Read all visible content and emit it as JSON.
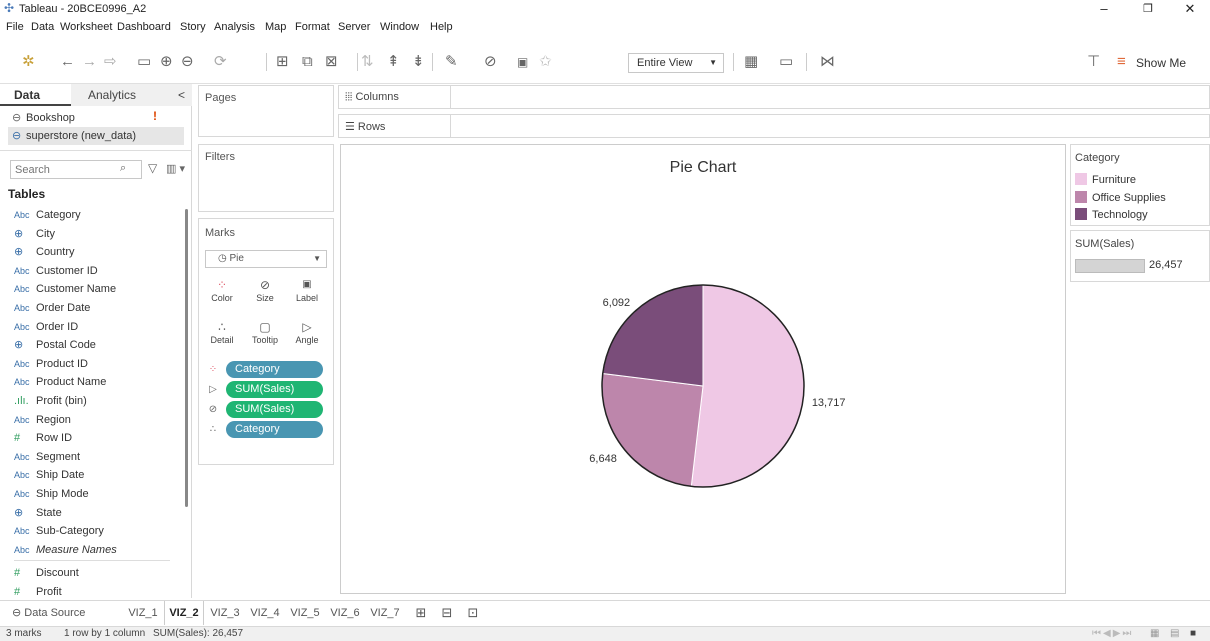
{
  "window": {
    "title": "Tableau - 20BCE0996_A2",
    "minimize": "–",
    "restore": "❐",
    "close": "✕"
  },
  "menu": [
    "File",
    "Data",
    "Worksheet",
    "Dashboard",
    "Story",
    "Analysis",
    "Map",
    "Format",
    "Server",
    "Window",
    "Help"
  ],
  "toolbar": {
    "fit_value": "Entire View",
    "show_me": "Show Me"
  },
  "left_pane": {
    "tabs": [
      "Data",
      "Analytics"
    ],
    "collapse": "<",
    "data_sources": [
      {
        "name": "Bookshop",
        "warning": "!"
      },
      {
        "name": "superstore (new_data)"
      }
    ],
    "search_placeholder": "Search",
    "tables_heading": "Tables",
    "fields": [
      {
        "type": "Abc",
        "name": "Category"
      },
      {
        "type": "⊕",
        "name": "City"
      },
      {
        "type": "⊕",
        "name": "Country"
      },
      {
        "type": "Abc",
        "name": "Customer ID"
      },
      {
        "type": "Abc",
        "name": "Customer Name"
      },
      {
        "type": "Abc",
        "name": "Order Date"
      },
      {
        "type": "Abc",
        "name": "Order ID"
      },
      {
        "type": "⊕",
        "name": "Postal Code"
      },
      {
        "type": "Abc",
        "name": "Product ID"
      },
      {
        "type": "Abc",
        "name": "Product Name"
      },
      {
        "type": ".ılı.",
        "name": "Profit (bin)"
      },
      {
        "type": "Abc",
        "name": "Region"
      },
      {
        "type": "#",
        "name": "Row ID"
      },
      {
        "type": "Abc",
        "name": "Segment"
      },
      {
        "type": "Abc",
        "name": "Ship Date"
      },
      {
        "type": "Abc",
        "name": "Ship Mode"
      },
      {
        "type": "⊕",
        "name": "State"
      },
      {
        "type": "Abc",
        "name": "Sub-Category"
      },
      {
        "type": "Abc",
        "name": "Measure Names"
      },
      {
        "type": "#",
        "name": "Discount"
      },
      {
        "type": "#",
        "name": "Profit"
      }
    ]
  },
  "cards": {
    "pages": "Pages",
    "filters": "Filters",
    "columns": "Columns",
    "rows": "Rows",
    "marks": "Marks",
    "mark_type": "Pie",
    "mark_buttons": [
      "Color",
      "Size",
      "Label",
      "Detail",
      "Tooltip",
      "Angle"
    ],
    "mark_pills": [
      {
        "label": "Category",
        "kind": "blue"
      },
      {
        "label": "SUM(Sales)",
        "kind": "green"
      },
      {
        "label": "SUM(Sales)",
        "kind": "green"
      },
      {
        "label": "Category",
        "kind": "blue"
      }
    ]
  },
  "chart_data": {
    "type": "pie",
    "title": "Pie Chart",
    "categories": [
      "Furniture",
      "Office Supplies",
      "Technology"
    ],
    "values": [
      13717,
      6648,
      6092
    ],
    "labels": [
      "13,717",
      "6,648",
      "6,092"
    ],
    "colors": [
      "#efc8e5",
      "#bd86ab",
      "#7a4d7a"
    ],
    "start_angle_deg": 0
  },
  "legend": {
    "title": "Category",
    "items": [
      {
        "name": "Furniture",
        "color": "#efc8e5"
      },
      {
        "name": "Office Supplies",
        "color": "#bd86ab"
      },
      {
        "name": "Technology",
        "color": "#7a4d7a"
      }
    ],
    "size_title": "SUM(Sales)",
    "size_value": "26,457",
    "size_fill": 1.0
  },
  "sheet_tabs": {
    "data_source": "Data Source",
    "sheets": [
      "VIZ_1",
      "VIZ_2",
      "VIZ_3",
      "VIZ_4",
      "VIZ_5",
      "VIZ_6",
      "VIZ_7"
    ],
    "active": "VIZ_2"
  },
  "status": {
    "marks": "3 marks",
    "layout": "1 row by 1 column",
    "sum": "SUM(Sales): 26,457"
  }
}
